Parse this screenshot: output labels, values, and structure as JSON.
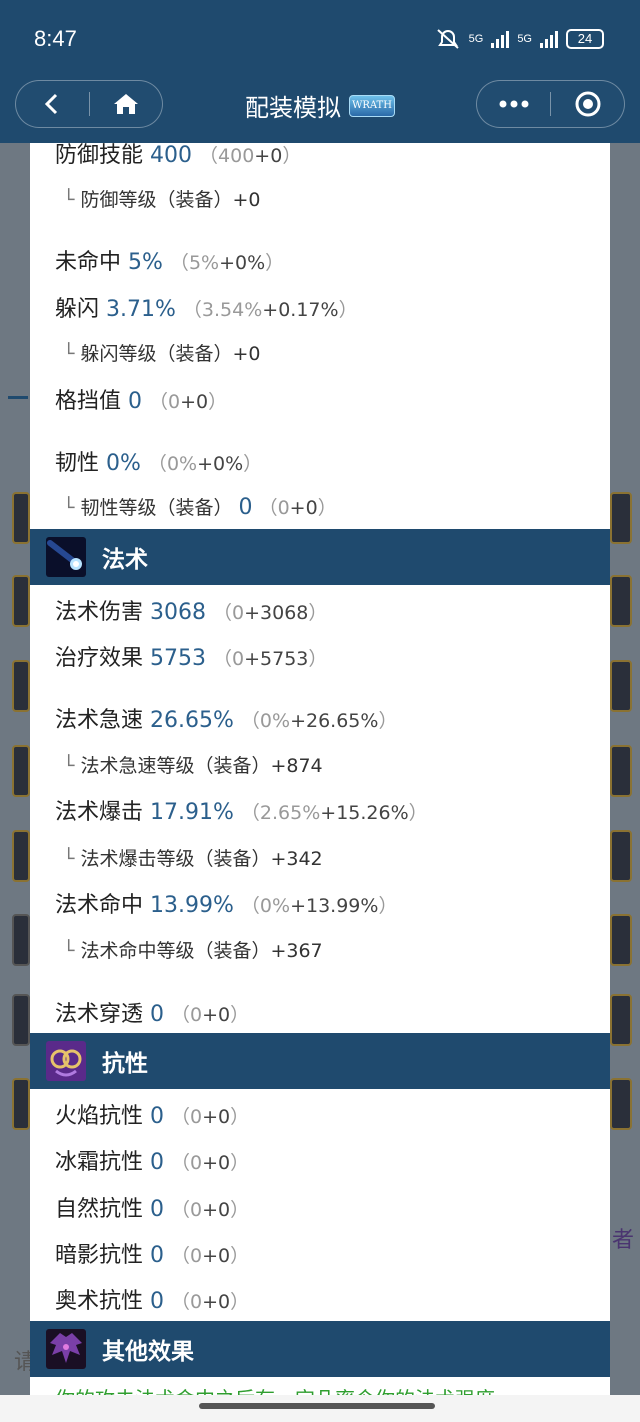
{
  "status_bar": {
    "time": "8:47",
    "network1": "5G",
    "network2": "5G",
    "battery": "24"
  },
  "header": {
    "title": "配装模拟",
    "logo_text": "WRATH"
  },
  "background": {
    "right_text": "者",
    "left_text": "请"
  },
  "top_stats": [
    {
      "label": "防御技能",
      "value": "400",
      "base": "400",
      "bonus": "+0",
      "suffix": ""
    }
  ],
  "defense_sub": {
    "label": "防御等级（装备）+0"
  },
  "miss": {
    "label": "未命中",
    "value": "5%",
    "base": "5%",
    "bonus": "+0%"
  },
  "dodge": {
    "label": "躲闪",
    "value": "3.71%",
    "base": "3.54%",
    "bonus": "+0.17%"
  },
  "dodge_sub": {
    "label": "躲闪等级（装备）+0"
  },
  "block": {
    "label": "格挡值",
    "value": "0",
    "base": "0",
    "bonus": "+0"
  },
  "resilience": {
    "label": "韧性",
    "value": "0%",
    "base": "0%",
    "bonus": "+0%"
  },
  "resilience_sub": {
    "label": "韧性等级（装备）",
    "value": "0",
    "base": "0",
    "bonus": "+0"
  },
  "spell_section": {
    "title": "法术"
  },
  "spell_damage": {
    "label": "法术伤害",
    "value": "3068",
    "base": "0",
    "bonus": "+3068"
  },
  "healing": {
    "label": "治疗效果",
    "value": "5753",
    "base": "0",
    "bonus": "+5753"
  },
  "spell_haste": {
    "label": "法术急速",
    "value": "26.65%",
    "base": "0%",
    "bonus": "+26.65%"
  },
  "spell_haste_sub": {
    "label": "法术急速等级（装备）+874"
  },
  "spell_crit": {
    "label": "法术爆击",
    "value": "17.91%",
    "base": "2.65%",
    "bonus": "+15.26%"
  },
  "spell_crit_sub": {
    "label": "法术爆击等级（装备）+342"
  },
  "spell_hit": {
    "label": "法术命中",
    "value": "13.99%",
    "base": "0%",
    "bonus": "+13.99%"
  },
  "spell_hit_sub": {
    "label": "法术命中等级（装备）+367"
  },
  "spell_pen": {
    "label": "法术穿透",
    "value": "0",
    "base": "0",
    "bonus": "+0"
  },
  "resist_section": {
    "title": "抗性"
  },
  "fire_res": {
    "label": "火焰抗性",
    "value": "0",
    "base": "0",
    "bonus": "+0"
  },
  "frost_res": {
    "label": "冰霜抗性",
    "value": "0",
    "base": "0",
    "bonus": "+0"
  },
  "nature_res": {
    "label": "自然抗性",
    "value": "0",
    "base": "0",
    "bonus": "+0"
  },
  "shadow_res": {
    "label": "暗影抗性",
    "value": "0",
    "base": "0",
    "bonus": "+0"
  },
  "arcane_res": {
    "label": "奥术抗性",
    "value": "0",
    "base": "0",
    "bonus": "+0"
  },
  "other_section": {
    "title": "其他效果"
  },
  "other_effect": {
    "text": "你的攻击法术命中之后有一定几率令你的法术强度"
  },
  "colors": {
    "header": "#1f4a6e",
    "value": "#2b5f8c",
    "green": "#2f9e2f"
  }
}
